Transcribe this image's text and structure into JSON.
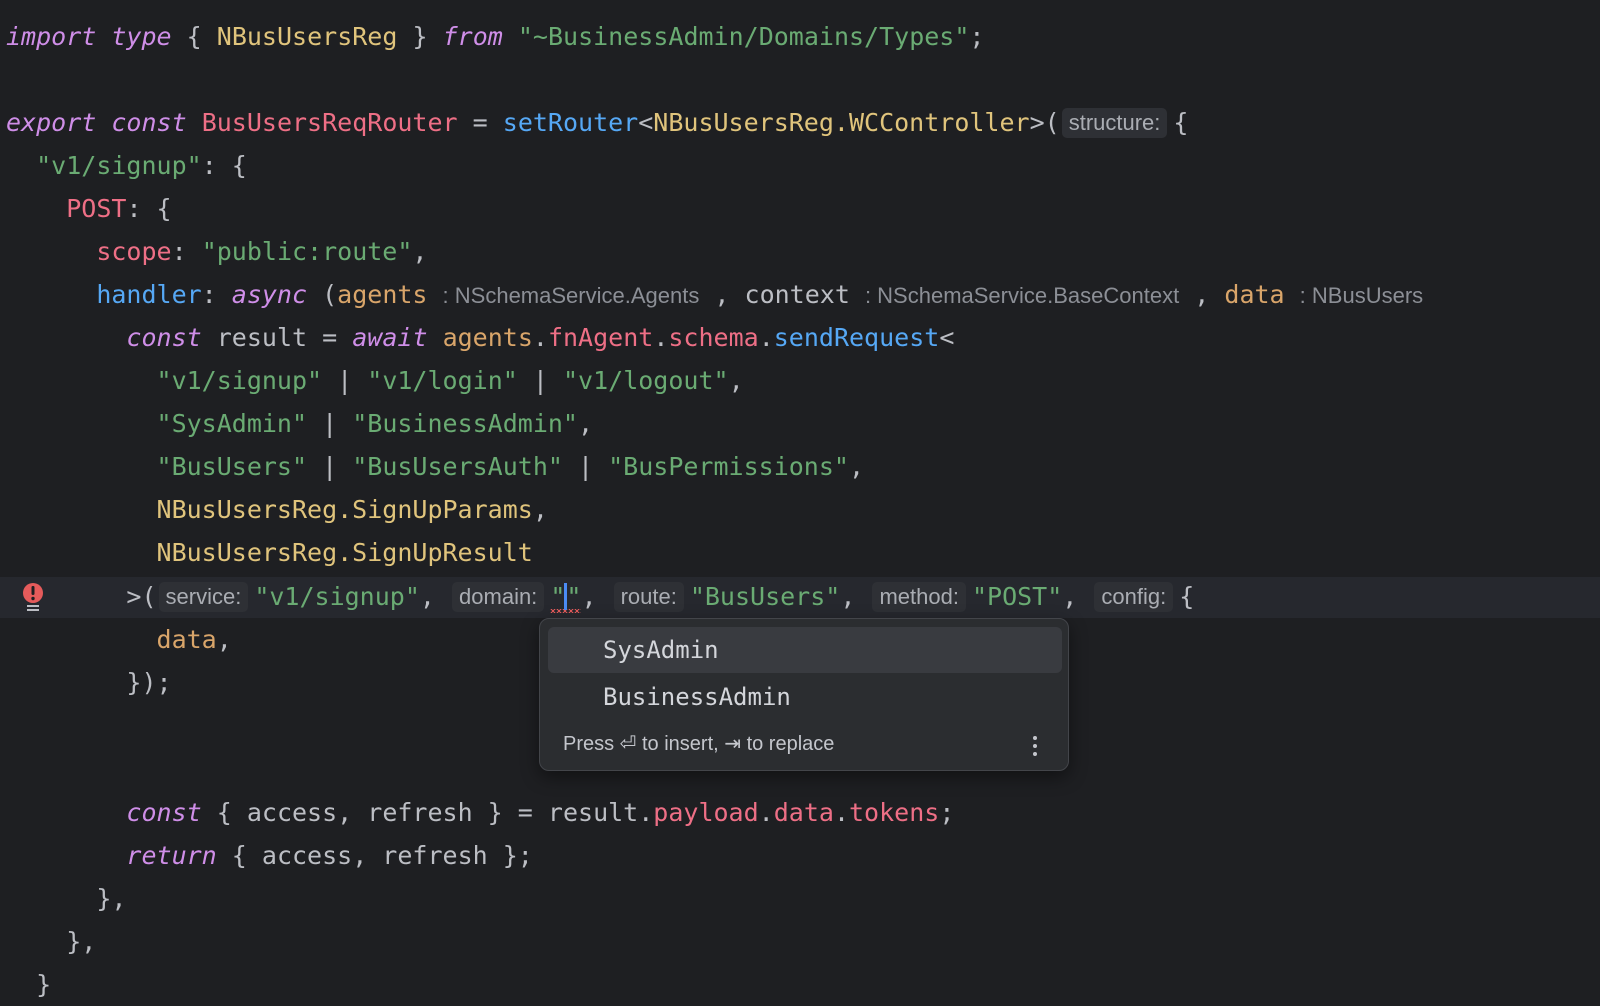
{
  "code": {
    "import_kw": "import",
    "type_kw": "type",
    "open_brace": "{",
    "import_name": "NBusUsersReg",
    "close_brace": "}",
    "from_kw": "from",
    "import_path": "\"~BusinessAdmin/Domains/Types\"",
    "semicolon": ";",
    "export_kw": "export",
    "const_kw": "const",
    "router_name": "BusUsersReqRouter",
    "eq": "=",
    "set_router": "setRouter",
    "generic_type": "NBusUsersReg.WCController",
    "gt_paren": ">(",
    "hint_structure": "structure:",
    "route_key": "\"v1/signup\"",
    "colon_brace": ": {",
    "post_key": "POST",
    "scope_key": "scope",
    "scope_value": "\"public:route\"",
    "comma": ",",
    "handler_key": "handler",
    "async_kw": "async",
    "open_paren": "(",
    "param_agents": "agents",
    "hint_agents_type": ": NSchemaService.Agents",
    "param_context": "context",
    "hint_context_type": ": NSchemaService.BaseContext",
    "param_data": "data",
    "hint_data_type": ": NBusUsers",
    "result_var": "result",
    "await_kw": "await",
    "agents_obj": "agents",
    "fn_agent": "fnAgent",
    "schema_prop": "schema",
    "send_request": "sendRequest",
    "lt": "<",
    "generic_line1": [
      "\"v1/signup\"",
      "\"v1/login\"",
      "\"v1/logout\""
    ],
    "generic_line2": [
      "\"SysAdmin\"",
      "\"BusinessAdmin\""
    ],
    "generic_line3": [
      "\"BusUsers\"",
      "\"BusUsersAuth\"",
      "\"BusPermissions\""
    ],
    "pipe": "|",
    "signup_params": "NBusUsersReg.SignUpParams",
    "signup_result": "NBusUsersReg.SignUpResult",
    "hint_service": "service:",
    "service_value": "\"v1/signup\"",
    "hint_domain": "domain:",
    "domain_value_open": "\"",
    "domain_value_close": "\"",
    "hint_route": "route:",
    "route_value": "\"BusUsers\"",
    "hint_method": "method:",
    "method_value": "\"POST\"",
    "hint_config": "config:",
    "data_arg": "data",
    "close_call": "});",
    "destructure_open": "{ access, refresh }",
    "result_ref": "result",
    "payload_prop": "payload",
    "data_prop": "data",
    "tokens_prop": "tokens",
    "return_kw": "return",
    "return_value": "{ access, refresh };",
    "close_obj_comma": "},"
  },
  "popup": {
    "items": [
      "SysAdmin",
      "BusinessAdmin"
    ],
    "footer": "Press ⏎ to insert, ⇥ to replace"
  },
  "colors": {
    "background": "#1e1f22",
    "keyword": "#cf8ee8",
    "string": "#6aab73",
    "type": "#e0c47c",
    "function": "#56a8f5",
    "property": "#c77dbb",
    "error": "#e55b5b"
  }
}
